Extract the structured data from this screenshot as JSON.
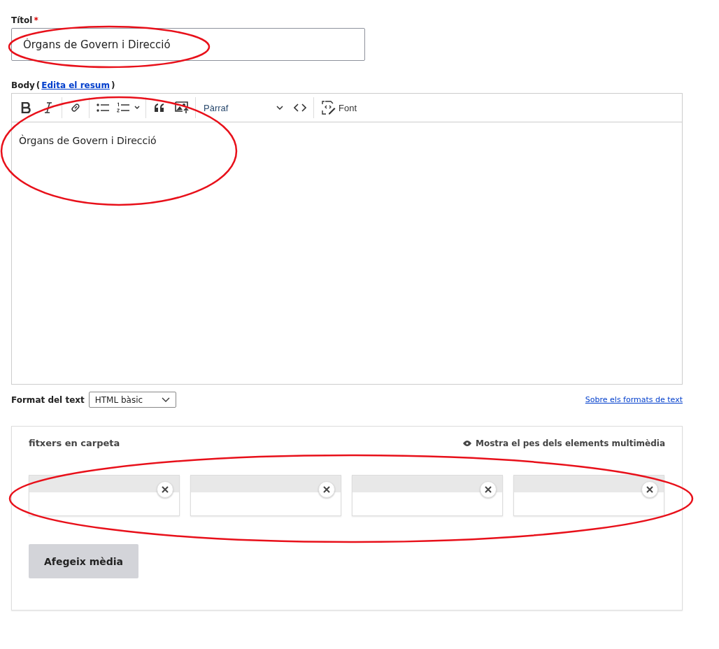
{
  "title_field": {
    "label": "Títol",
    "required": true,
    "required_mark": "*",
    "value": "Òrgans de Govern i Direcció"
  },
  "body_field": {
    "label": "Body",
    "summary_open": "(",
    "summary_link": "Edita el resum",
    "summary_close": ")",
    "toolbar": [
      {
        "kind": "bold"
      },
      {
        "kind": "italic"
      },
      {
        "kind": "separator"
      },
      {
        "kind": "link"
      },
      {
        "kind": "separator"
      },
      {
        "kind": "bulleted"
      },
      {
        "kind": "numbered"
      },
      {
        "kind": "separator"
      },
      {
        "kind": "quote"
      },
      {
        "kind": "image"
      },
      {
        "kind": "separator"
      },
      {
        "kind": "heading",
        "label": "Pàrraf"
      },
      {
        "kind": "code"
      },
      {
        "kind": "separator"
      },
      {
        "kind": "source",
        "label": "Font"
      }
    ],
    "content": "Òrgans de Govern i Direcció"
  },
  "text_format": {
    "label": "Format del text",
    "value": "HTML bàsic",
    "help_link": "Sobre els formats de text"
  },
  "media": {
    "title": "fitxers en carpeta",
    "weights_toggle": "Mostra el pes dels elements multimèdia",
    "items": [
      {
        "removable": true
      },
      {
        "removable": true
      },
      {
        "removable": true
      },
      {
        "removable": true
      }
    ],
    "add_button": "Afegeix mèdia"
  }
}
